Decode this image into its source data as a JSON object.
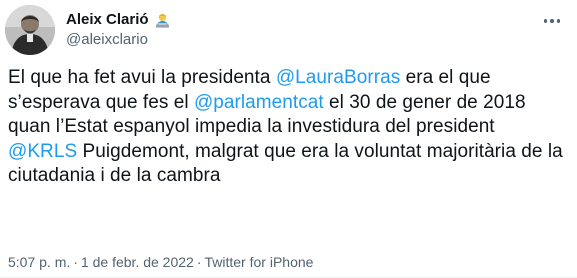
{
  "author": {
    "display_name": "Aleix Clarió",
    "handle": "@aleixclario",
    "emoji_icon": "person-at-laptop-emoji"
  },
  "tweet": {
    "segments": [
      {
        "type": "text",
        "value": "El que ha fet avui la presidenta "
      },
      {
        "type": "mention",
        "value": "@LauraBorras"
      },
      {
        "type": "text",
        "value": " era el que s’esperava que fes el "
      },
      {
        "type": "mention",
        "value": "@parlamentcat"
      },
      {
        "type": "text",
        "value": " el 30 de gener de 2018 quan l’Estat espanyol impedia la investidura del president "
      },
      {
        "type": "mention",
        "value": "@KRLS"
      },
      {
        "type": "text",
        "value": " Puigdemont, malgrat que era la voluntat majoritària de la ciutadania i de la cambra"
      }
    ]
  },
  "meta": {
    "time": "5:07 p. m.",
    "separator": "·",
    "date": "1 de febr. de 2022",
    "source": "Twitter for iPhone"
  },
  "colors": {
    "accent": "#1d9bf0",
    "text": "#0f1419",
    "secondary": "#536471"
  }
}
